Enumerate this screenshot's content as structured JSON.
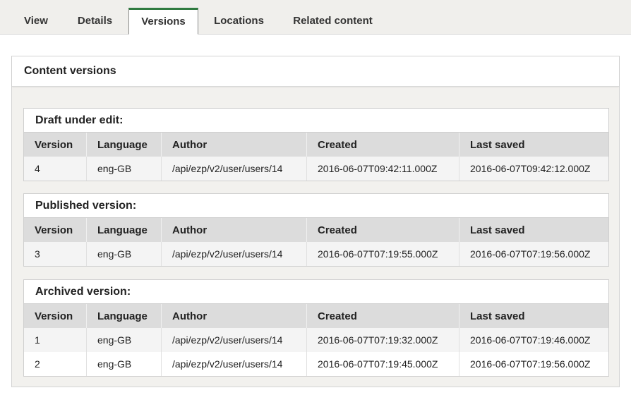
{
  "tabs": [
    "View",
    "Details",
    "Versions",
    "Locations",
    "Related content"
  ],
  "active_tab": "Versions",
  "accent_color": "#2f7a3f",
  "panel": {
    "title": "Content versions"
  },
  "columns": [
    "Version",
    "Language",
    "Author",
    "Created",
    "Last saved"
  ],
  "sections": [
    {
      "title": "Draft under edit:",
      "rows": [
        [
          "4",
          "eng-GB",
          "/api/ezp/v2/user/users/14",
          "2016-06-07T09:42:11.000Z",
          "2016-06-07T09:42:12.000Z"
        ]
      ]
    },
    {
      "title": "Published version:",
      "rows": [
        [
          "3",
          "eng-GB",
          "/api/ezp/v2/user/users/14",
          "2016-06-07T07:19:55.000Z",
          "2016-06-07T07:19:56.000Z"
        ]
      ]
    },
    {
      "title": "Archived version:",
      "rows": [
        [
          "1",
          "eng-GB",
          "/api/ezp/v2/user/users/14",
          "2016-06-07T07:19:32.000Z",
          "2016-06-07T07:19:46.000Z"
        ],
        [
          "2",
          "eng-GB",
          "/api/ezp/v2/user/users/14",
          "2016-06-07T07:19:45.000Z",
          "2016-06-07T07:19:56.000Z"
        ]
      ]
    }
  ]
}
